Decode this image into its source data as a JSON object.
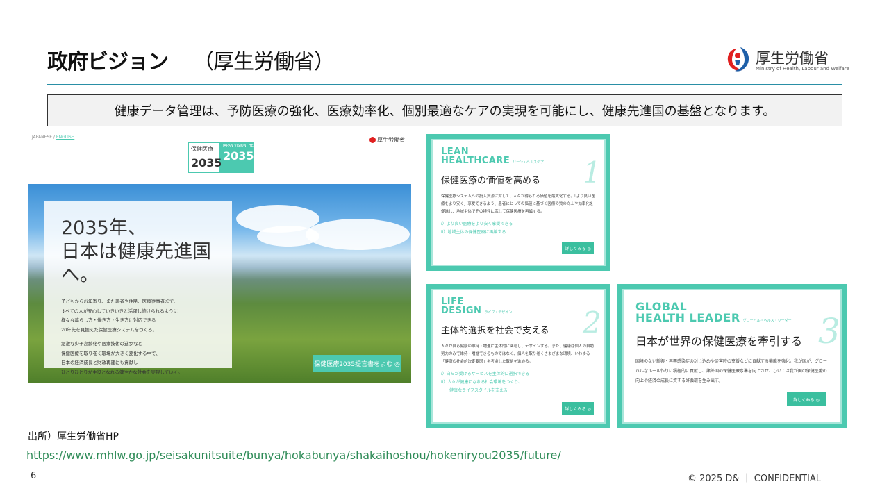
{
  "header": {
    "title": "政府ビジョン",
    "subtitle": "（厚生労働省）",
    "logo_name": "厚生労働省",
    "logo_en": "Ministry of Health, Labour and Welfare"
  },
  "message": "健康データ管理は、予防医療の強化、医療効率化、個別最適なケアの実現を可能にし、健康先進国の基盤となります。",
  "screenshot": {
    "nav_jp": "JAPANESE",
    "nav_sep": "/",
    "nav_en": "ENGLISH",
    "mini_logo": "厚生労働省",
    "badge_left_text": "保健医療",
    "badge_left_year": "2035",
    "badge_right_text": "JAPAN VISION: HEALTH CARE",
    "badge_right_year": "2035",
    "hero_heading": "2035年、\n日本は健康先進国へ。",
    "hero_para1": "子どもからお年寄り、また患者や住民、医療従事者まで、\nすべての人が安心していきいきと活躍し続けられるように\n様々な暮らし方・働き方・生き方に対応できる\n20年先を見据えた保健医療システムをつくる。",
    "hero_para2": "急激な少子高齢化や医療技術の進歩など\n保健医療を取り巻く環境が大きく変化する中で、\n日本の経済成長と財政再建にも貢献し\nひとりひとりが主役となれる健やかな社会を実現していく。",
    "hero_button": "保健医療2035提言書をよむ ◎"
  },
  "cards": [
    {
      "en": "LEAN\nHEALTHCARE",
      "kana": "リーン・ヘルスケア",
      "jp": "保健医療の価値を高める",
      "num": "1",
      "body": "保健医療システムへの投入資源に対して、人々が得られる価値を最大化する。「より良い医療をより安く」享受できるよう、患者にとっての価値に基づく医療の質の向上や効率化を促進し、地域主体でその特性に応じて保健医療を再編する。",
      "list": "i）より良い医療をより安く享受できる\nii）地域主体の保健医療に再編する",
      "button": "詳しくみる ◎"
    },
    {
      "en": "LIFE\nDESIGN",
      "kana": "ライフ・デザイン",
      "jp": "主体的選択を社会で支える",
      "num": "2",
      "body": "人々が自ら健康の維持・増進に主体的に関与し、デザインする。また、健康は個人の自助努力のみで維持・増進できるものではなく、個人を取り巻くさまざまな環境、いわゆる「健康の社会的決定要因」を考慮した取組を進める。",
      "list": "i）自らが受けるサービスを主体的に選択できる\nii）人々が健康になれる社会環境をつくり、\n　　健康なライフスタイルを支える",
      "button": "詳しくみる ◎"
    },
    {
      "en": "GLOBAL\nHEALTH LEADER",
      "kana": "グローバル・ヘルス・リーダー",
      "jp": "日本が世界の保健医療を牽引する",
      "num": "3",
      "body": "国境のない新興・再興感染症の封じ込めや災害時の支援などに貢献する機能を強化。我が国が、グローバルなルール作りに積極的に貢献し、諸外国の保健医療水準を向上させ、ひいては我が国の保健医療の向上や経済の成長に資する好循環を生み出す。",
      "button": "詳しくみる ◎"
    }
  ],
  "source_label": "出所）厚生労働省HP",
  "source_url": "https://www.mhlw.go.jp/seisakunitsuite/bunya/hokabunya/shakaihoshou/hokeniryou2035/future/",
  "page_number": "6",
  "footer": "© 2025 D&amp;  ｜  CONFIDENTIAL",
  "colors": {
    "accent": "#4cc9b0",
    "rule": "#2a8fa6",
    "link": "#2e8b57",
    "logo_red": "#e02020",
    "logo_blue": "#1e5fa8"
  }
}
